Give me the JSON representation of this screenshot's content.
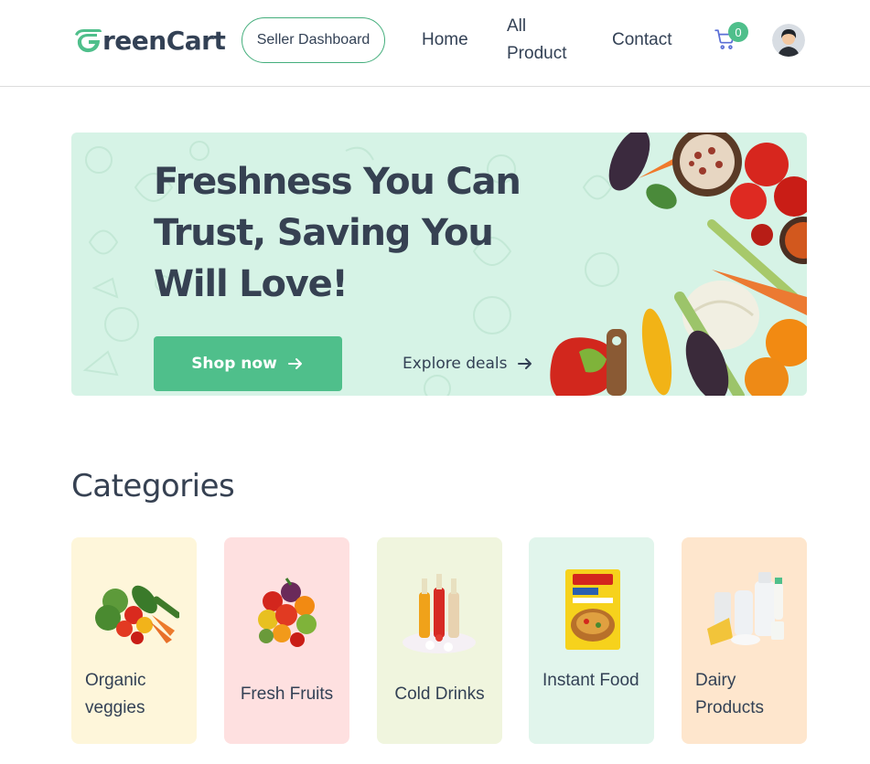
{
  "navbar": {
    "logo_text": "reenCart",
    "logo_icon": "leaf-g-icon",
    "seller_dashboard_label": "Seller Dashboard",
    "links": [
      {
        "label": "Home"
      },
      {
        "label": "All Product"
      },
      {
        "label": "Contact"
      }
    ],
    "cart_count": "0",
    "cart_icon": "shopping-cart-icon",
    "avatar_icon": "user-avatar-icon"
  },
  "hero": {
    "title": "Freshness You Can Trust, Saving You Will Love!",
    "shop_now_label": "Shop now",
    "explore_deals_label": "Explore deals",
    "arrow_icon": "arrow-right-icon"
  },
  "categories": {
    "title": "Categories",
    "items": [
      {
        "label": "Organic veggies",
        "bg": "#fef6da",
        "icon": "vegetables-image"
      },
      {
        "label": "Fresh Fruits",
        "bg": "#fee0e0",
        "icon": "fruits-image"
      },
      {
        "label": "Cold Drinks",
        "bg": "#f0f5de",
        "icon": "cold-drinks-image"
      },
      {
        "label": "Instant Food",
        "bg": "#e1f5ec",
        "icon": "instant-noodles-image"
      },
      {
        "label": "Dairy Products",
        "bg": "#fee6cd",
        "icon": "dairy-image"
      }
    ]
  },
  "colors": {
    "brand": "#4fbf8b",
    "text": "#334155",
    "hero_bg": "#d6f3e6"
  }
}
